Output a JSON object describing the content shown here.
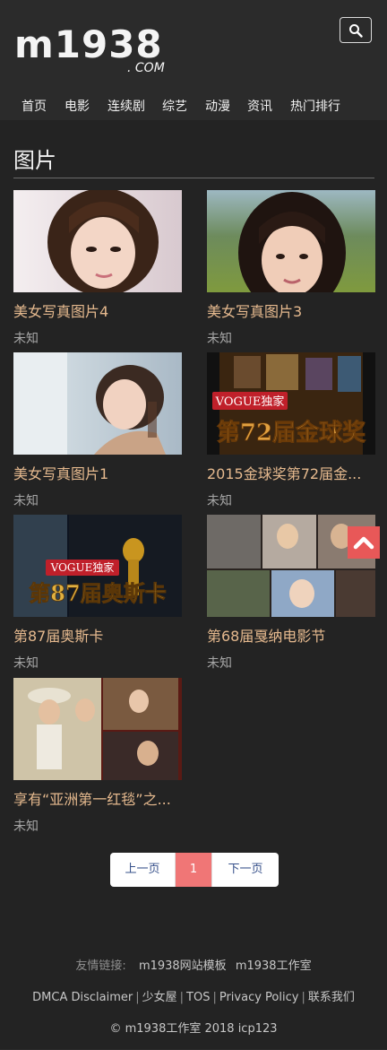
{
  "header": {
    "logo_main": "m1938",
    "logo_sub": ". COM",
    "nav": [
      "首页",
      "电影",
      "连续剧",
      "综艺",
      "动漫",
      "资讯",
      "热门排行"
    ]
  },
  "section": {
    "title": "图片"
  },
  "cards": [
    {
      "title": "美女写真图片4",
      "sub": "未知"
    },
    {
      "title": "美女写真图片3",
      "sub": "未知"
    },
    {
      "title": "美女写真图片1",
      "sub": "未知"
    },
    {
      "title": "2015金球奖第72届金...",
      "sub": "未知",
      "badge": "VOGUE独家",
      "caption": "第72届金球奖"
    },
    {
      "title": "第87届奥斯卡",
      "sub": "未知",
      "badge": "VOGUE独家",
      "caption": "第87届奥斯卡"
    },
    {
      "title": "第68届戛纳电影节",
      "sub": "未知"
    },
    {
      "title": "享有“亚洲第一红毯”之...",
      "sub": "未知"
    }
  ],
  "pagination": {
    "prev": "上一页",
    "current": "1",
    "next": "下一页"
  },
  "footer": {
    "links_label": "友情链接:",
    "links": [
      "m1938网站模板",
      "m1938工作室"
    ],
    "legal": [
      "DMCA Disclaimer",
      "少女屋",
      "TOS",
      "Privacy Policy",
      "联系我们"
    ],
    "copyright": "© m1938工作室 2018 icp123"
  },
  "colors": {
    "accent": "#e85858",
    "page_active": "#f07676",
    "card_title": "#e5b98e"
  },
  "icons": {
    "search": "search-icon",
    "back_to_top": "chevron-up-icon"
  }
}
